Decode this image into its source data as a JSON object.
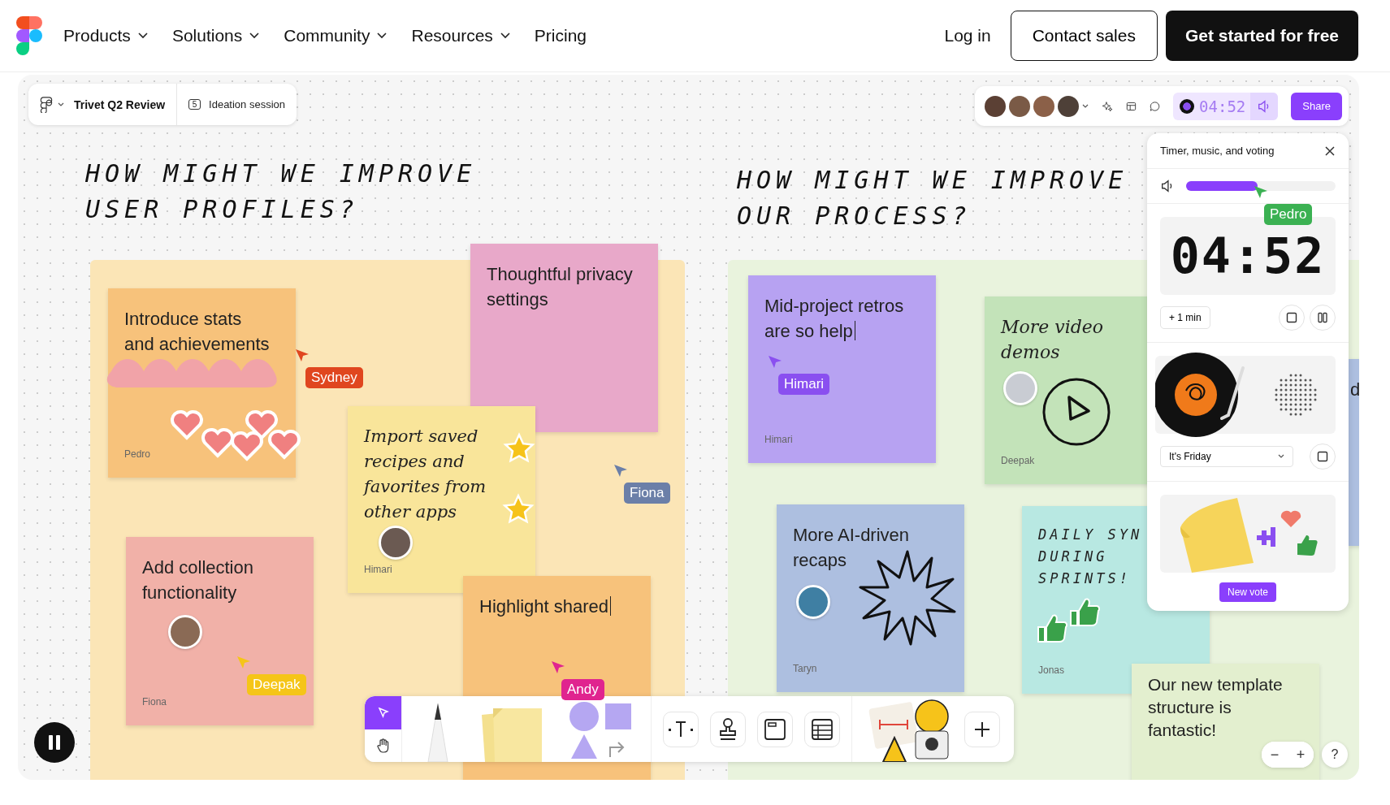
{
  "nav": {
    "items": [
      {
        "label": "Products",
        "has_menu": true
      },
      {
        "label": "Solutions",
        "has_menu": true
      },
      {
        "label": "Community",
        "has_menu": true
      },
      {
        "label": "Resources",
        "has_menu": true
      },
      {
        "label": "Pricing",
        "has_menu": false
      }
    ],
    "login": "Log in",
    "contact": "Contact sales",
    "cta": "Get started for free"
  },
  "board": {
    "file_name": "Trivet Q2 Review",
    "session": "Ideation session",
    "session_count": "5",
    "timer_pill": "04:52",
    "share": "Share",
    "headings": [
      "HOW MIGHT WE IMPROVE USER PROFILES?",
      "HOW MIGHT WE IMPROVE OUR PROCESS?"
    ],
    "notes": [
      {
        "text": "Introduce stats and achievements",
        "author": "Pedro",
        "kind": "typed",
        "color": "#f7c27b",
        "editing": false
      },
      {
        "text": "Thoughtful privacy settings",
        "kind": "typed",
        "color": "#e8a8c9",
        "editing": false
      },
      {
        "text": "Import saved recipes and favorites from other apps",
        "author": "Himari",
        "kind": "handwritten",
        "color": "#f9e59a",
        "editing": false
      },
      {
        "text": "Add collection functionality",
        "author": "Fiona",
        "kind": "typed",
        "color": "#f1b1a8",
        "editing": false
      },
      {
        "text": "Highlight shared",
        "kind": "typed",
        "color": "#f7c27b",
        "editing": true
      },
      {
        "text": "Mid-project retros are so help",
        "author": "Himari",
        "kind": "typed",
        "color": "#b7a2f2",
        "editing": true
      },
      {
        "text": "More video demos",
        "author": "Deepak",
        "kind": "handwritten",
        "color": "#c3e3b9",
        "editing": false
      },
      {
        "text": "More AI-driven recaps",
        "author": "Taryn",
        "kind": "typed",
        "color": "#adbfe0",
        "editing": false
      },
      {
        "text": "DAILY SYN DURING SPRINTS!",
        "author": "Jonas",
        "kind": "caps",
        "color": "#b8e8e2",
        "editing": false
      },
      {
        "text": "Our new template structure is fantastic!",
        "kind": "typed",
        "color": "#e3efcf",
        "editing": false
      },
      {
        "text": "d",
        "kind": "typed",
        "color": "#adbfe0",
        "editing": false
      }
    ],
    "cursors": [
      {
        "name": "Sydney",
        "color": "#e0461f"
      },
      {
        "name": "Fiona",
        "color": "#6b7fa8"
      },
      {
        "name": "Himari",
        "color": "#8a4ff0"
      },
      {
        "name": "Deepak",
        "color": "#f5c518"
      },
      {
        "name": "Pedro",
        "color": "#3bb152"
      },
      {
        "name": "Andy",
        "color": "#e0248f"
      }
    ],
    "panel": {
      "title": "Timer, music, and voting",
      "volume": {
        "level": 0.48
      },
      "timer": "04:52",
      "add_time": "+ 1 min",
      "track": "It's Friday",
      "new_vote": "New vote"
    },
    "zoom": {
      "out": "−",
      "in": "+"
    },
    "help": "?"
  }
}
